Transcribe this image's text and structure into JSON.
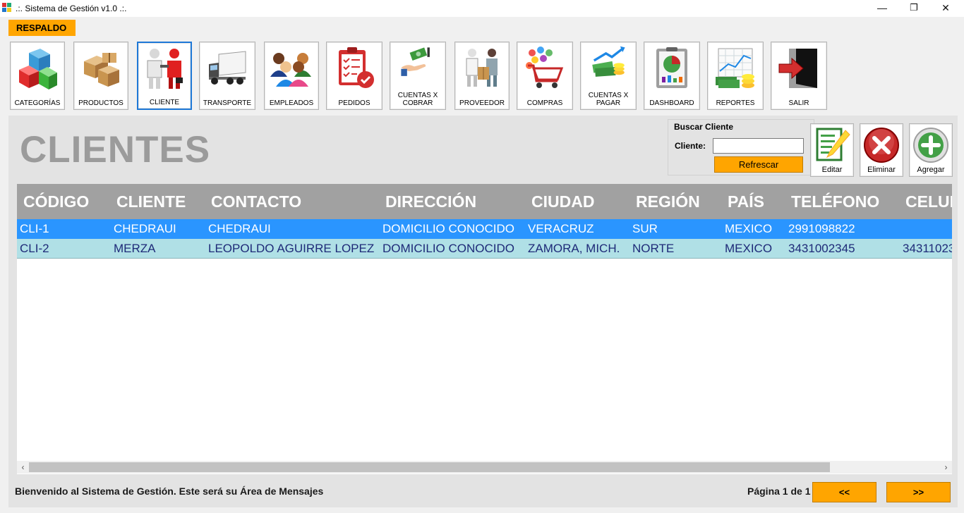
{
  "window": {
    "title": ".:. Sistema de Gestión v1.0 .:.",
    "minimize": "—",
    "restore": "❐",
    "close": "✕"
  },
  "menu": {
    "backup_label": "RESPALDO"
  },
  "toolbar": [
    {
      "label": "CATEGORÍAS",
      "icon": "cubes-icon"
    },
    {
      "label": "PRODUCTOS",
      "icon": "boxes-icon"
    },
    {
      "label": "CLIENTE",
      "icon": "handshake-icon",
      "active": true
    },
    {
      "label": "TRANSPORTE",
      "icon": "truck-icon"
    },
    {
      "label": "EMPLEADOS",
      "icon": "people-icon"
    },
    {
      "label": "PEDIDOS",
      "icon": "clipboard-check-icon"
    },
    {
      "label": "CUENTAS X COBRAR",
      "icon": "money-hand-icon"
    },
    {
      "label": "PROVEEDOR",
      "icon": "delivery-icon"
    },
    {
      "label": "COMPRAS",
      "icon": "shopping-cart-icon"
    },
    {
      "label": "CUENTAS X PAGAR",
      "icon": "money-stack-icon"
    },
    {
      "label": "DASHBOARD",
      "icon": "pie-chart-icon"
    },
    {
      "label": "REPORTES",
      "icon": "report-chart-icon"
    },
    {
      "label": "SALIR",
      "icon": "exit-door-icon"
    }
  ],
  "main": {
    "title": "CLIENTES",
    "search": {
      "legend": "Buscar Cliente",
      "label": "Cliente:",
      "value": "",
      "refresh_label": "Refrescar"
    },
    "actions": {
      "edit_label": "Editar",
      "delete_label": "Eliminar",
      "add_label": "Agregar"
    },
    "grid": {
      "columns": [
        "CÓDIGO",
        "CLIENTE",
        "CONTACTO",
        "DIRECCIÓN",
        "CIUDAD",
        "REGIÓN",
        "PAÍS",
        "TELÉFONO",
        "CELUL"
      ],
      "rows": [
        [
          "CLI-1",
          "CHEDRAUI",
          "CHEDRAUI",
          "DOMICILIO CONOCIDO",
          "VERACRUZ",
          "SUR",
          "MEXICO",
          "2991098822",
          ""
        ],
        [
          "CLI-2",
          "MERZA",
          "LEOPOLDO AGUIRRE LOPEZ",
          "DOMICILIO CONOCIDO",
          "ZAMORA, MICH.",
          "NORTE",
          "MEXICO",
          "3431002345",
          "34311023"
        ]
      ],
      "selected_row": 0
    }
  },
  "status": {
    "message": "Bienvenido al Sistema de Gestión. Este será su Área de Mensajes",
    "page_info": "Página 1 de 1",
    "prev_label": "<<",
    "next_label": ">>"
  },
  "colors": {
    "accent": "#ffa500",
    "selection": "#2a95ff",
    "alt_row": "#b0e0e6",
    "header": "#a1a1a1"
  }
}
